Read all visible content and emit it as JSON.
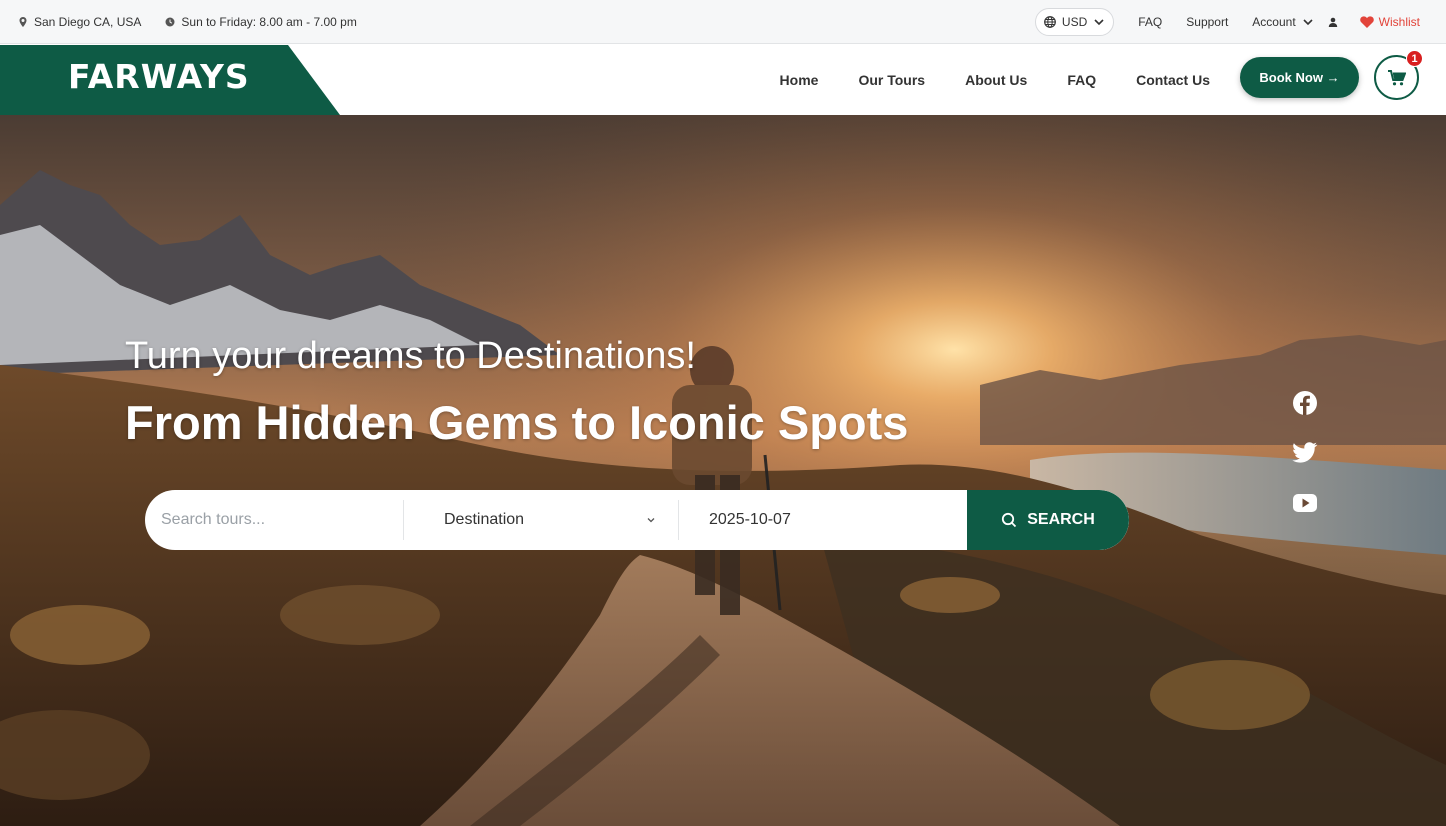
{
  "topbar": {
    "location": "San Diego CA, USA",
    "hours": "Sun to Friday: 8.00 am - 7.00 pm",
    "currency": "USD",
    "faq": "FAQ",
    "support": "Support",
    "account": "Account",
    "wishlist": "Wishlist"
  },
  "header": {
    "logo": "FARWAYS",
    "nav": [
      "Home",
      "Our Tours",
      "About Us",
      "FAQ",
      "Contact Us"
    ],
    "book_label": "Book Now →",
    "cart_count": "1"
  },
  "hero": {
    "subtitle": "Turn your dreams to Destinations!",
    "title": "From Hidden Gems to Iconic Spots",
    "search_placeholder": "Search tours...",
    "destination_value": "Destination",
    "date_value": "2025-10-07",
    "search_label": "SEARCH"
  },
  "social": [
    "facebook-icon",
    "twitter-icon",
    "youtube-icon"
  ],
  "colors": {
    "brand_green": "#0e5b45",
    "wishlist_red": "#e2443a",
    "badge_red": "#d81f1f"
  }
}
